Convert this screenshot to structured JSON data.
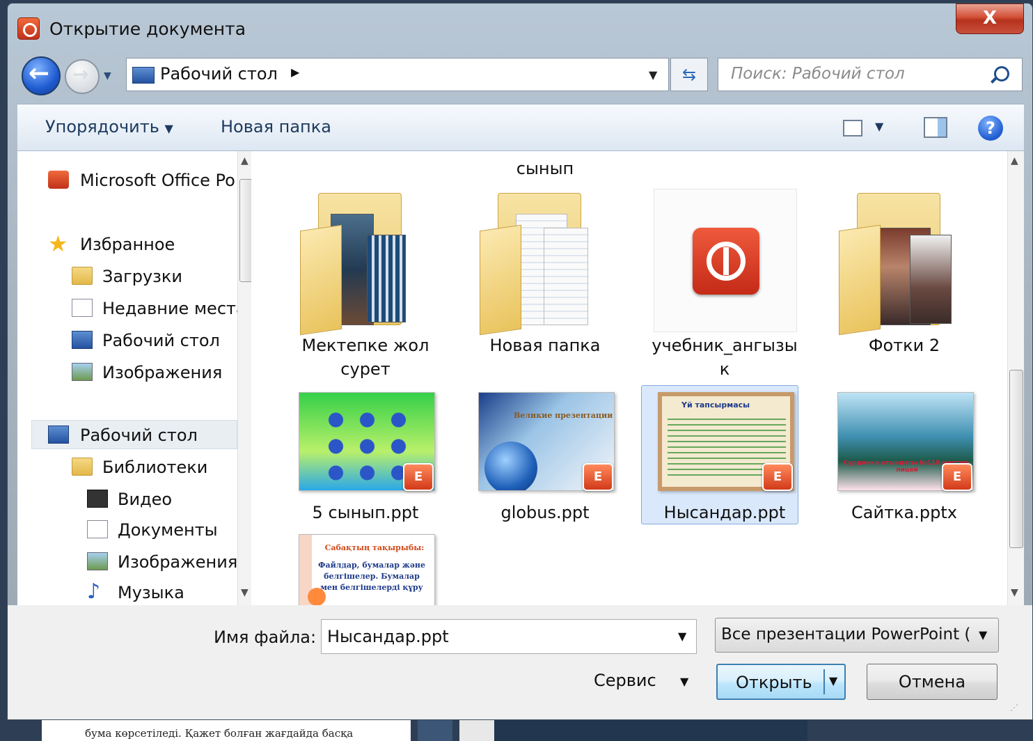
{
  "window": {
    "title": "Открытие документа",
    "close_label": "X"
  },
  "nav": {
    "address": "Рабочий стол",
    "search_placeholder": "Поиск: Рабочий стол"
  },
  "toolbar": {
    "organize": "Упорядочить",
    "new_folder": "Новая папка"
  },
  "sidebar": {
    "items": [
      {
        "label": "Microsoft Office Po",
        "icon": "powerpoint-icon"
      },
      {
        "label": "Избранное",
        "icon": "star-icon"
      },
      {
        "label": "Загрузки",
        "icon": "downloads-folder-icon"
      },
      {
        "label": "Недавние места",
        "icon": "recent-places-icon"
      },
      {
        "label": "Рабочий стол",
        "icon": "desktop-icon"
      },
      {
        "label": "Изображения",
        "icon": "pictures-icon"
      },
      {
        "label": "Рабочий стол",
        "icon": "desktop-icon"
      },
      {
        "label": "Библиотеки",
        "icon": "libraries-icon"
      },
      {
        "label": "Видео",
        "icon": "video-icon"
      },
      {
        "label": "Документы",
        "icon": "documents-icon"
      },
      {
        "label": "Изображения",
        "icon": "pictures-icon"
      },
      {
        "label": "Музыка",
        "icon": "music-icon"
      }
    ]
  },
  "files": {
    "partial_label": "сынып",
    "items": [
      {
        "label_line1": "Мектепке жол",
        "label_line2": "сурет",
        "type": "folder"
      },
      {
        "label_line1": "Новая папка",
        "label_line2": "",
        "type": "folder"
      },
      {
        "label_line1": "учебник_ангызы",
        "label_line2": "к",
        "type": "application"
      },
      {
        "label_line1": "Фотки 2",
        "label_line2": "",
        "type": "folder"
      },
      {
        "label_line1": "5 сынып.ppt",
        "label_line2": "",
        "type": "ppt"
      },
      {
        "label_line1": "globus.ppt",
        "label_line2": "",
        "type": "ppt"
      },
      {
        "label_line1": "Нысандар.ppt",
        "label_line2": "",
        "type": "ppt",
        "selected": true
      },
      {
        "label_line1": "Сайтка.pptx",
        "label_line2": "",
        "type": "pptx"
      }
    ],
    "slide_texts": {
      "globus_title": "Великие презентации",
      "nysandar_title": "Үй тапсырмасы",
      "saitka_caption": "Сурдинко атындагы №118 мектеп-лицей",
      "ninth_title": "Сабақтың тақырыбы:",
      "ninth_body": "Файлдар, бумалар және белгішелер. Бумалар мен белгішелерді құру"
    }
  },
  "bottom": {
    "filename_label": "Имя файла:",
    "filename_value": "Нысандар.ppt",
    "filter_value": "Все презентации PowerPoint (",
    "tools_label": "Сервис",
    "open_label": "Открыть",
    "cancel_label": "Отмена"
  },
  "background": {
    "doc_text": "бума көрсетіледі. Қажет болған жағдайда басқа"
  },
  "colors": {
    "accent": "#3c7fb1",
    "selection": "#d9e8fb",
    "close_button": "#c9503a"
  }
}
